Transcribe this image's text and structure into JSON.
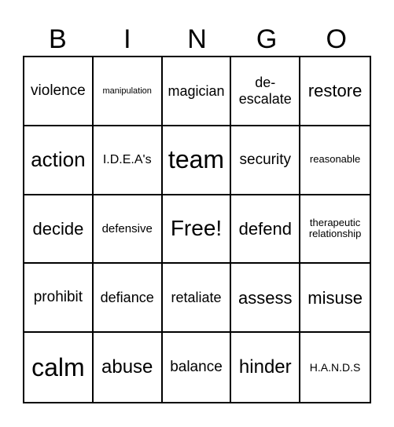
{
  "header": {
    "letters": [
      "B",
      "I",
      "N",
      "G",
      "O"
    ]
  },
  "board": {
    "rows": [
      [
        "violence",
        "manipulation",
        "magician",
        "de-\nescalate",
        "restore"
      ],
      [
        "action",
        "I.D.E.A's",
        "team",
        "security",
        "reasonable"
      ],
      [
        "decide",
        "defensive",
        "Free!",
        "defend",
        "therapeutic relationship"
      ],
      [
        "prohibit",
        "defiance",
        "retaliate",
        "assess",
        "misuse"
      ],
      [
        "calm",
        "abuse",
        "balance",
        "hinder",
        "H.A.N.D.S"
      ]
    ],
    "free_space": "Free!"
  }
}
